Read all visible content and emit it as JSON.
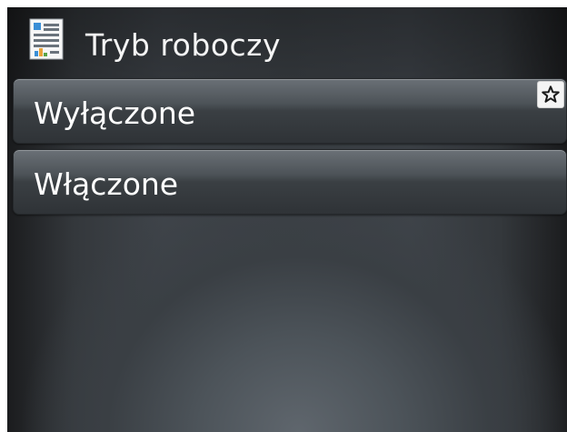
{
  "header": {
    "title": "Tryb roboczy",
    "icon": "report-document-icon"
  },
  "menu": {
    "items": [
      {
        "label": "Wyłączone",
        "favorite_icon": "star-icon",
        "is_favorite": true
      },
      {
        "label": "Włączone"
      }
    ]
  }
}
